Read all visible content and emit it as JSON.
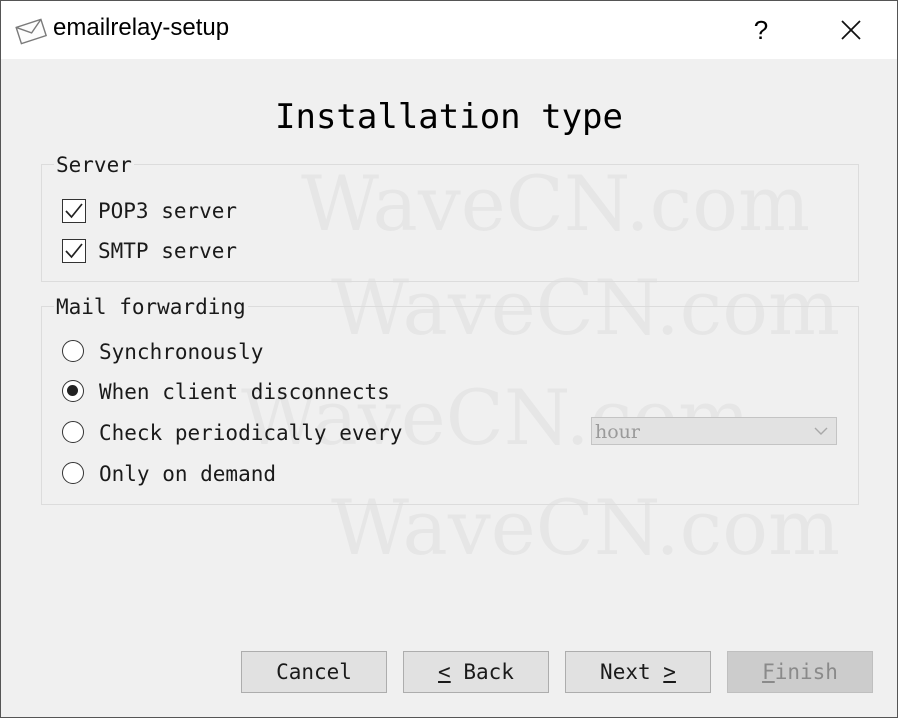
{
  "window": {
    "title": "emailrelay-setup",
    "help_label": "?",
    "title_icon": "envelope-icon",
    "close_icon": "close-icon"
  },
  "watermark": "WaveCN.com",
  "page": {
    "heading": "Installation type"
  },
  "server_group": {
    "legend": "Server",
    "items": [
      {
        "label": "POP3 server",
        "checked": true
      },
      {
        "label": "SMTP server",
        "checked": true
      }
    ]
  },
  "forwarding_group": {
    "legend": "Mail forwarding",
    "options": [
      {
        "label": "Synchronously",
        "selected": false
      },
      {
        "label": "When client disconnects",
        "selected": true
      },
      {
        "label": "Check periodically every",
        "selected": false
      },
      {
        "label": "Only on demand",
        "selected": false
      }
    ],
    "interval_select": {
      "value": "hour",
      "enabled": false
    }
  },
  "buttons": {
    "cancel": "Cancel",
    "back_glyph": "<",
    "back": "Back",
    "next": "Next",
    "next_glyph": ">",
    "finish_mnemonic": "F",
    "finish_rest": "inish"
  }
}
